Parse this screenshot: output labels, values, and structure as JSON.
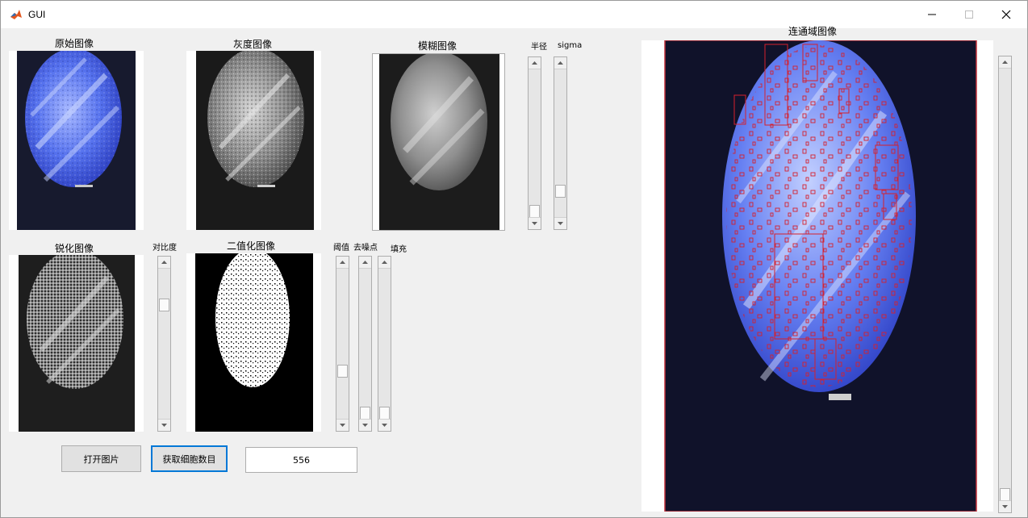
{
  "window": {
    "title": "GUI",
    "controls": [
      "minimize-icon",
      "maximize-icon",
      "close-icon"
    ]
  },
  "panels": {
    "original": "原始图像",
    "gray": "灰度图像",
    "blur": "模糊图像",
    "sharpen": "锐化图像",
    "binary": "二值化图像",
    "connected": "连通域图像"
  },
  "sliders": {
    "radius_label": "半径",
    "sigma_label": "sigma",
    "contrast_label": "对比度",
    "threshold_label": "阈值",
    "denoise_label": "去噪点",
    "fill_label": "填充",
    "values": {
      "radius": 1.0,
      "sigma": 0.85,
      "contrast": 0.22,
      "threshold": 0.7,
      "denoise": 1.0,
      "fill": 1.0,
      "right_scroll": 1.0
    }
  },
  "buttons": {
    "open_image": "打开图片",
    "count_cells": "获取细胞数目"
  },
  "result": {
    "count": "556"
  },
  "colors": {
    "accent": "#0078d7",
    "box_border": "#d6202c",
    "cell_blue": "#4a6cf0"
  }
}
